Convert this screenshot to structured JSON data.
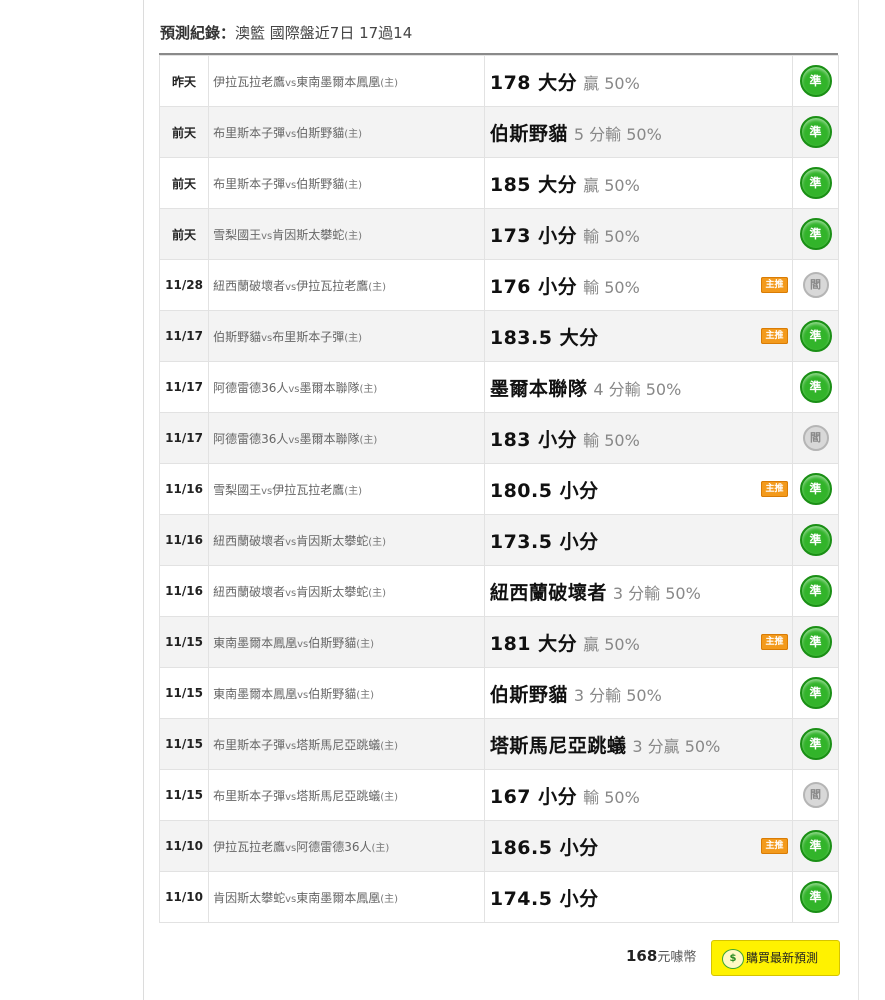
{
  "header": {
    "label": "預測紀錄：",
    "summary": "澳籃 國際盤近7日 17過14"
  },
  "records": [
    {
      "date": "昨天",
      "match_a": "伊拉瓦拉老鷹",
      "vs": "vs",
      "match_b": "東南墨爾本鳳凰",
      "home_mark": "(主)",
      "pick": "178 大分",
      "result": "贏 50%",
      "tag": "",
      "status": "準",
      "status_type": "ok"
    },
    {
      "date": "前天",
      "match_a": "布里斯本子彈",
      "vs": "vs",
      "match_b": "伯斯野貓",
      "home_mark": "(主)",
      "pick": "伯斯野貓",
      "result": "5 分輸 50%",
      "tag": "",
      "status": "準",
      "status_type": "ok"
    },
    {
      "date": "前天",
      "match_a": "布里斯本子彈",
      "vs": "vs",
      "match_b": "伯斯野貓",
      "home_mark": "(主)",
      "pick": "185 大分",
      "result": "贏 50%",
      "tag": "",
      "status": "準",
      "status_type": "ok"
    },
    {
      "date": "前天",
      "match_a": "雪梨國王",
      "vs": "vs",
      "match_b": "肯因斯太攀蛇",
      "home_mark": "(主)",
      "pick": "173 小分",
      "result": "輸 50%",
      "tag": "",
      "status": "準",
      "status_type": "ok"
    },
    {
      "date": "11/28",
      "match_a": "紐西蘭破壞者",
      "vs": "vs",
      "match_b": "伊拉瓦拉老鷹",
      "home_mark": "(主)",
      "pick": "176 小分",
      "result": "輸 50%",
      "tag": "主推",
      "status": "閻",
      "status_type": "push"
    },
    {
      "date": "11/17",
      "match_a": "伯斯野貓",
      "vs": "vs",
      "match_b": "布里斯本子彈",
      "home_mark": "(主)",
      "pick": "183.5 大分",
      "result": "",
      "tag": "主推",
      "status": "準",
      "status_type": "ok"
    },
    {
      "date": "11/17",
      "match_a": "阿德雷德36人",
      "vs": "vs",
      "match_b": "墨爾本聯隊",
      "home_mark": "(主)",
      "pick": "墨爾本聯隊",
      "result": "4 分輸 50%",
      "tag": "",
      "status": "準",
      "status_type": "ok"
    },
    {
      "date": "11/17",
      "match_a": "阿德雷德36人",
      "vs": "vs",
      "match_b": "墨爾本聯隊",
      "home_mark": "(主)",
      "pick": "183 小分",
      "result": "輸 50%",
      "tag": "",
      "status": "閻",
      "status_type": "push"
    },
    {
      "date": "11/16",
      "match_a": "雪梨國王",
      "vs": "vs",
      "match_b": "伊拉瓦拉老鷹",
      "home_mark": "(主)",
      "pick": "180.5 小分",
      "result": "",
      "tag": "主推",
      "status": "準",
      "status_type": "ok"
    },
    {
      "date": "11/16",
      "match_a": "紐西蘭破壞者",
      "vs": "vs",
      "match_b": "肯因斯太攀蛇",
      "home_mark": "(主)",
      "pick": "173.5 小分",
      "result": "",
      "tag": "",
      "status": "準",
      "status_type": "ok"
    },
    {
      "date": "11/16",
      "match_a": "紐西蘭破壞者",
      "vs": "vs",
      "match_b": "肯因斯太攀蛇",
      "home_mark": "(主)",
      "pick": "紐西蘭破壞者",
      "result": "3 分輸 50%",
      "tag": "",
      "status": "準",
      "status_type": "ok"
    },
    {
      "date": "11/15",
      "match_a": "東南墨爾本鳳凰",
      "vs": "vs",
      "match_b": "伯斯野貓",
      "home_mark": "(主)",
      "pick": "181 大分",
      "result": "贏 50%",
      "tag": "主推",
      "status": "準",
      "status_type": "ok"
    },
    {
      "date": "11/15",
      "match_a": "東南墨爾本鳳凰",
      "vs": "vs",
      "match_b": "伯斯野貓",
      "home_mark": "(主)",
      "pick": "伯斯野貓",
      "result": "3 分輸 50%",
      "tag": "",
      "status": "準",
      "status_type": "ok"
    },
    {
      "date": "11/15",
      "match_a": "布里斯本子彈",
      "vs": "vs",
      "match_b": "塔斯馬尼亞跳蟻",
      "home_mark": "(主)",
      "pick": "塔斯馬尼亞跳蟻",
      "result": "3 分贏 50%",
      "tag": "",
      "status": "準",
      "status_type": "ok"
    },
    {
      "date": "11/15",
      "match_a": "布里斯本子彈",
      "vs": "vs",
      "match_b": "塔斯馬尼亞跳蟻",
      "home_mark": "(主)",
      "pick": "167 小分",
      "result": "輸 50%",
      "tag": "",
      "status": "閻",
      "status_type": "push"
    },
    {
      "date": "11/10",
      "match_a": "伊拉瓦拉老鷹",
      "vs": "vs",
      "match_b": "阿德雷德36人",
      "home_mark": "(主)",
      "pick": "186.5 小分",
      "result": "",
      "tag": "主推",
      "status": "準",
      "status_type": "ok"
    },
    {
      "date": "11/10",
      "match_a": "肯因斯太攀蛇",
      "vs": "vs",
      "match_b": "東南墨爾本鳳凰",
      "home_mark": "(主)",
      "pick": "174.5 小分",
      "result": "",
      "tag": "",
      "status": "準",
      "status_type": "ok"
    }
  ],
  "footer": {
    "price": "168",
    "price_unit": "元噱幣",
    "coin_icon": "coin-icon",
    "buy_label": "購買最新預測"
  },
  "colors": {
    "accent_green": "#32b42a",
    "push_grey": "#d8d8d8",
    "tag_orange": "#f39a1c",
    "buy_yellow": "#fff200"
  }
}
